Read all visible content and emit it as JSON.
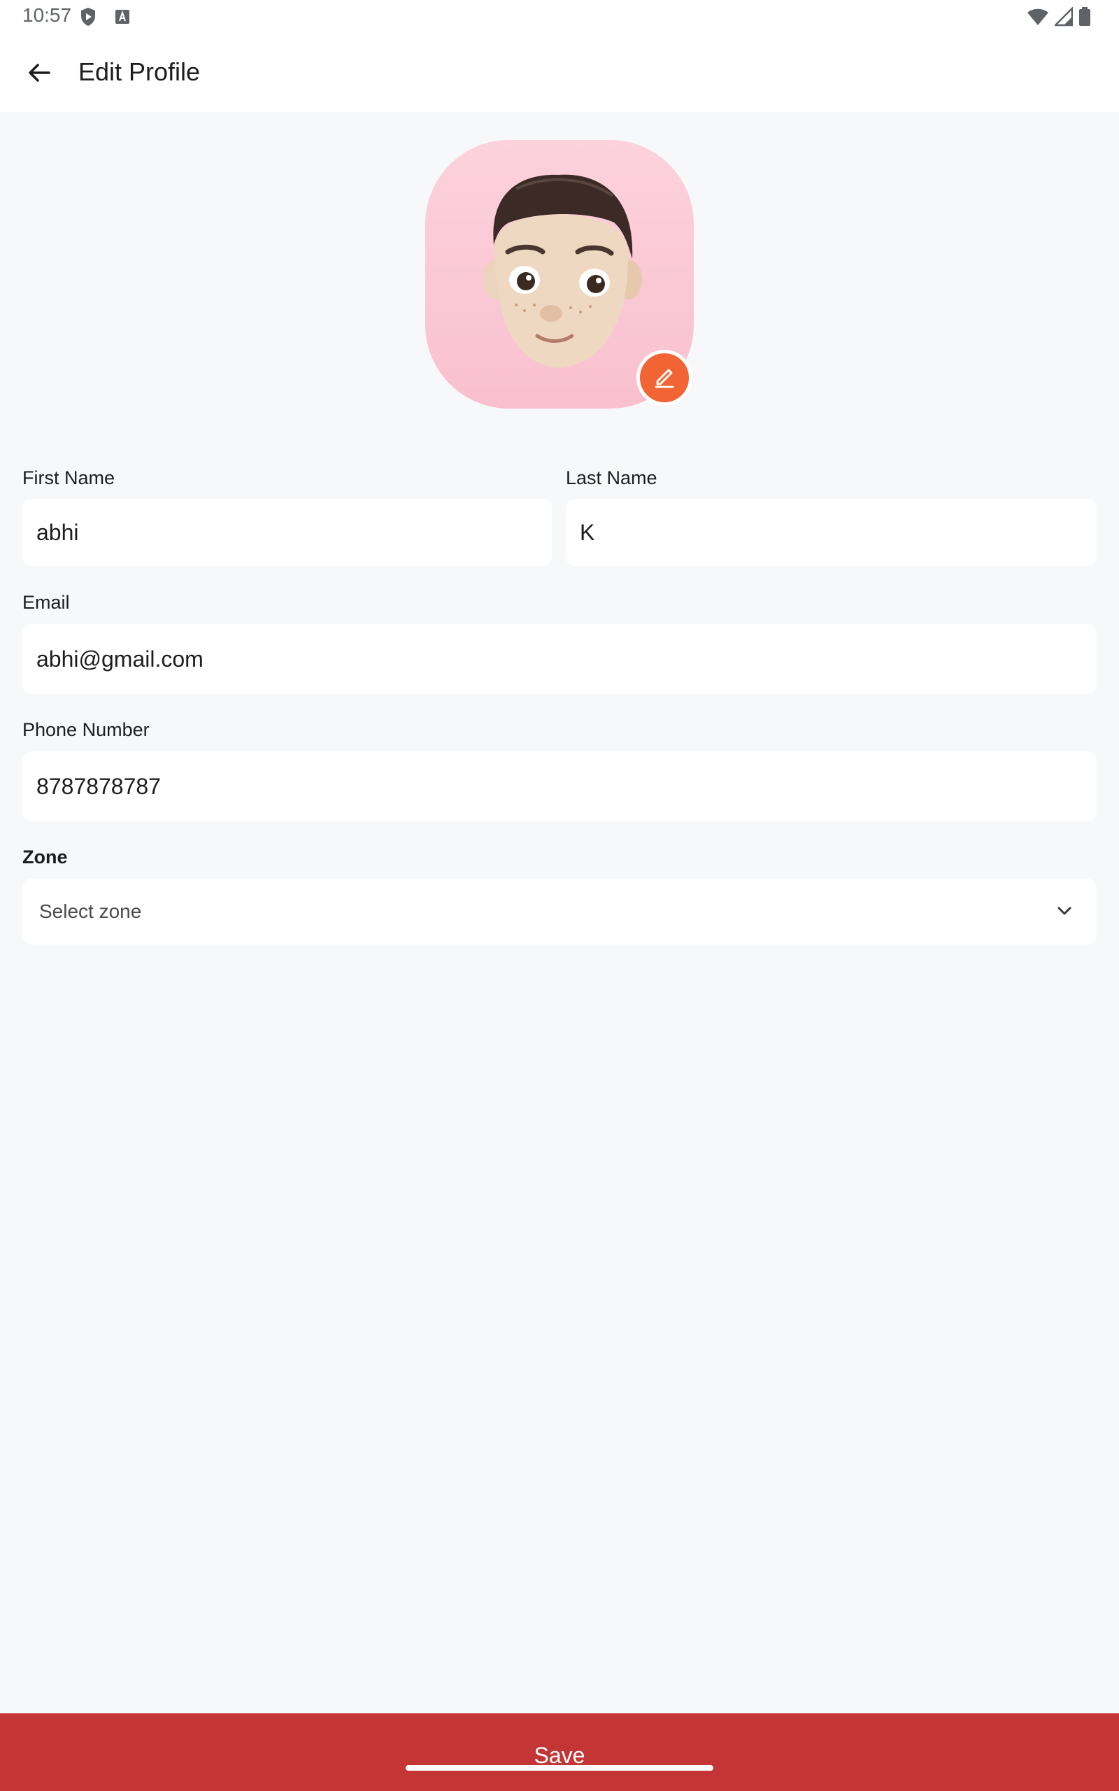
{
  "status_bar": {
    "time": "10:57",
    "left_icons": [
      "shield-play-icon",
      "keyboard-a-icon"
    ],
    "right_icons": [
      "wifi-icon",
      "cellular-signal-icon",
      "battery-icon"
    ]
  },
  "app_bar": {
    "title": "Edit Profile",
    "back_icon": "arrow-left-icon"
  },
  "avatar": {
    "description_icon": "memoji-avatar",
    "edit_icon": "pencil-icon",
    "edit_color": "#f26433",
    "background_color": "#fcd2dc"
  },
  "form": {
    "first_name": {
      "label": "First Name",
      "value": "abhi"
    },
    "last_name": {
      "label": "Last Name",
      "value": "K"
    },
    "email": {
      "label": "Email",
      "value": "abhi@gmail.com"
    },
    "phone": {
      "label": "Phone Number",
      "value": "8787878787"
    },
    "zone": {
      "label": "Zone",
      "placeholder": "Select zone",
      "chevron_icon": "chevron-down-icon"
    }
  },
  "footer": {
    "save_label": "Save",
    "save_color": "#c43535"
  }
}
